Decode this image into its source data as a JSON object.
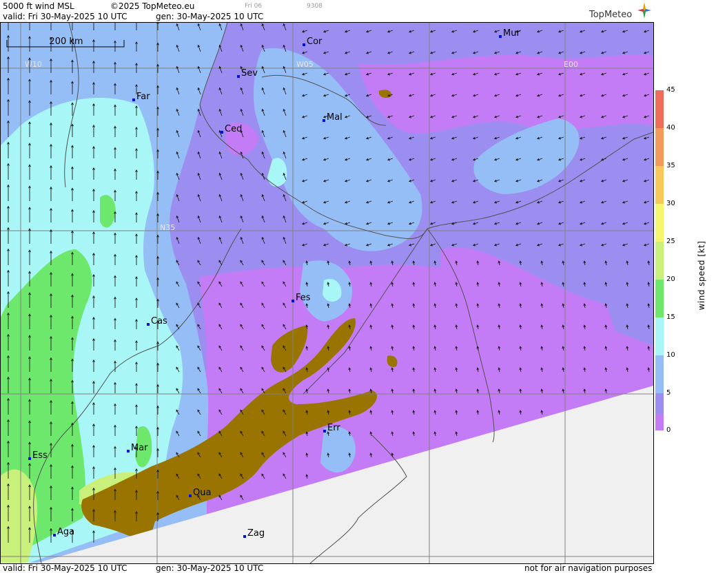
{
  "header": {
    "product": "5000 ft wind MSL",
    "copyright": "©2025 TopMeteo.eu",
    "day_code": "Fri 06",
    "run_code": "9308",
    "valid": "valid:  Fri  30-May-2025  10 UTC",
    "generated": "gen:  30-May-2025 10 UTC"
  },
  "footer": {
    "valid": "valid:  Fri  30-May-2025  10 UTC",
    "generated": "gen:  30-May-2025 10 UTC",
    "disclaimer": "not for air navigation purposes"
  },
  "brand": {
    "name": "TopMeteo"
  },
  "scale_bar": {
    "label": "200 km"
  },
  "grid_labels": {
    "w10": "W10",
    "w05": "W05",
    "e00": "E00",
    "n35": "N35"
  },
  "cities": [
    {
      "name": "Cor"
    },
    {
      "name": "Mur"
    },
    {
      "name": "Sev"
    },
    {
      "name": "Far"
    },
    {
      "name": "Ced"
    },
    {
      "name": "Mal"
    },
    {
      "name": "Fes"
    },
    {
      "name": "Cas"
    },
    {
      "name": "Err"
    },
    {
      "name": "Mar"
    },
    {
      "name": "Ess"
    },
    {
      "name": "Oua"
    },
    {
      "name": "Aga"
    },
    {
      "name": "Zag"
    }
  ],
  "legend": {
    "unit": "wind speed [kt]",
    "ticks": [
      "45",
      "40",
      "35",
      "30",
      "25",
      "20",
      "15",
      "10",
      "5",
      "0"
    ],
    "colors": {
      "0-5": "#c47cf6",
      "5-10": "#9c8ef0",
      "10-15": "#96bef6",
      "15-20": "#a8f6f6",
      "20-25": "#6ee86c",
      "25-30": "#c8f07a",
      "30-35": "#f6f66c",
      "35-40": "#f8c85a",
      "40-45": "#f49a5a",
      "45+": "#ee6c5a",
      "terrain": "#9a7400",
      "no_data": "#f0f0f0"
    }
  }
}
